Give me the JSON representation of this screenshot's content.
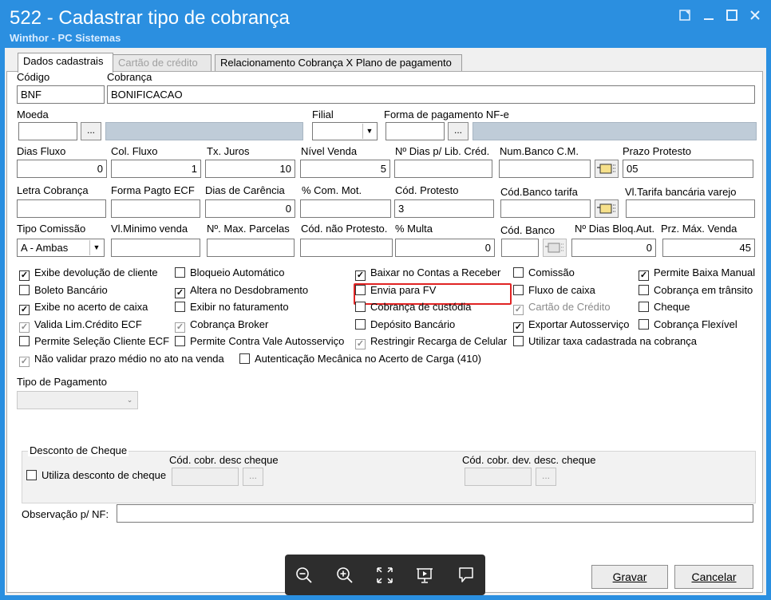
{
  "window": {
    "title": "522 - Cadastrar tipo de cobrança",
    "subtitle": "Winthor - PC Sistemas",
    "controls": [
      "restore-icon",
      "minimize-icon",
      "maximize-icon",
      "close-icon"
    ]
  },
  "tabs": [
    {
      "label": "Dados cadastrais",
      "state": "active"
    },
    {
      "label": "Cartão de crédito",
      "state": "disabled"
    },
    {
      "label": "Relacionamento Cobrança X Plano de pagamento",
      "state": "normal"
    }
  ],
  "fields": {
    "codigo": {
      "label": "Código",
      "value": "BNF"
    },
    "cobranca": {
      "label": "Cobrança",
      "value": "BONIFICACAO"
    },
    "moeda": {
      "label": "Moeda",
      "value": ""
    },
    "filial": {
      "label": "Filial",
      "value": ""
    },
    "forma_pagamento_nfe": {
      "label": "Forma de pagamento NF-e",
      "value": ""
    },
    "dias_fluxo": {
      "label": "Dias Fluxo",
      "value": "0"
    },
    "col_fluxo": {
      "label": "Col. Fluxo",
      "value": "1"
    },
    "tx_juros": {
      "label": "Tx. Juros",
      "value": "10"
    },
    "nivel_venda": {
      "label": "Nível Venda",
      "value": "5"
    },
    "dias_lib_cred": {
      "label": "Nº Dias p/ Lib. Créd.",
      "value": ""
    },
    "num_banco_cm": {
      "label": "Num.Banco C.M.",
      "value": ""
    },
    "prazo_protesto": {
      "label": "Prazo Protesto",
      "value": "05"
    },
    "letra_cobranca": {
      "label": "Letra Cobrança",
      "value": ""
    },
    "forma_pagto_ecf": {
      "label": "Forma Pagto ECF",
      "value": ""
    },
    "dias_carencia": {
      "label": "Dias de Carência",
      "value": "0"
    },
    "com_mot": {
      "label": "% Com. Mot.",
      "value": ""
    },
    "cod_protesto": {
      "label": "Cód. Protesto",
      "value": "3"
    },
    "cod_banco_tarifa": {
      "label": "Cód.Banco tarifa",
      "value": ""
    },
    "vl_tarifa_bancaria": {
      "label": "Vl.Tarifa bancária varejo",
      "value": ""
    },
    "tipo_comissao": {
      "label": "Tipo Comissão",
      "value": "A - Ambas"
    },
    "vl_minimo_venda": {
      "label": "Vl.Minimo venda",
      "value": ""
    },
    "max_parcelas": {
      "label": "Nº. Max. Parcelas",
      "value": ""
    },
    "cod_nao_protesto": {
      "label": "Cód. não Protesto.",
      "value": ""
    },
    "multa": {
      "label": "% Multa",
      "value": "0"
    },
    "cod_banco": {
      "label": "Cód. Banco",
      "value": ""
    },
    "dias_bloq_aut": {
      "label": "Nº Dias Bloq.Aut.",
      "value": "0"
    },
    "prz_max_venda": {
      "label": "Prz. Máx. Venda",
      "value": "45"
    }
  },
  "checkboxes": {
    "col1": [
      {
        "label": "Exibe devolução de cliente",
        "checked": true,
        "disabled": false
      },
      {
        "label": "Boleto Bancário",
        "checked": false,
        "disabled": false
      },
      {
        "label": "Exibe no acerto de caixa",
        "checked": true,
        "disabled": false
      },
      {
        "label": "Valida Lim.Crédito ECF",
        "checked": true,
        "disabled": true
      },
      {
        "label": "Permite Seleção Cliente ECF",
        "checked": false,
        "disabled": false
      },
      {
        "label": "Não validar prazo médio no ato na venda",
        "checked": true,
        "disabled": true
      }
    ],
    "col2": [
      {
        "label": "Bloqueio Automático",
        "checked": false,
        "disabled": false
      },
      {
        "label": "Altera no Desdobramento",
        "checked": true,
        "disabled": false
      },
      {
        "label": "Exibir no faturamento",
        "checked": false,
        "disabled": false
      },
      {
        "label": "Cobrança Broker",
        "checked": true,
        "disabled": true
      },
      {
        "label": "Permite Contra Vale Autosserviço",
        "checked": false,
        "disabled": false
      },
      {
        "label": "Autenticação Mecânica no Acerto de Carga (410)",
        "checked": false,
        "disabled": false
      }
    ],
    "col3": [
      {
        "label": "Baixar no Contas a Receber",
        "checked": true,
        "disabled": false
      },
      {
        "label": "Envia para FV",
        "checked": false,
        "disabled": false
      },
      {
        "label": "Cobrança de custódia",
        "checked": false,
        "disabled": false
      },
      {
        "label": "Depósito Bancário",
        "checked": false,
        "disabled": false
      },
      {
        "label": "Restringir Recarga de Celular",
        "checked": true,
        "disabled": true
      }
    ],
    "col4": [
      {
        "label": "Comissão",
        "checked": false,
        "disabled": false
      },
      {
        "label": "Fluxo de caixa",
        "checked": false,
        "disabled": false
      },
      {
        "label": "Cartão de Crédito",
        "checked": true,
        "disabled": true
      },
      {
        "label": "Exportar Autosserviço",
        "checked": true,
        "disabled": false
      },
      {
        "label": "Utilizar taxa cadastrada na cobrança",
        "checked": false,
        "disabled": false
      }
    ],
    "col5": [
      {
        "label": "Permite Baixa Manual",
        "checked": true,
        "disabled": false
      },
      {
        "label": "Cobrança em trânsito",
        "checked": false,
        "disabled": false
      },
      {
        "label": "Cheque",
        "checked": false,
        "disabled": false
      },
      {
        "label": "Cobrança Flexível",
        "checked": false,
        "disabled": false
      }
    ]
  },
  "tipo_pagamento": {
    "label": "Tipo de Pagamento",
    "value": ""
  },
  "desconto_cheque": {
    "title": "Desconto de Cheque",
    "utiliza_label": "Utiliza desconto de cheque",
    "utiliza_checked": false,
    "cod_desc_label": "Cód. cobr. desc cheque",
    "cod_dev_label": "Cód. cobr. dev. desc. cheque"
  },
  "observacao": {
    "label": "Observação p/ NF:",
    "value": ""
  },
  "buttons": {
    "ellipsis": "...",
    "gravar": "Gravar",
    "cancelar": "Cancelar"
  },
  "viewer_toolbar": [
    "zoom-out-icon",
    "zoom-in-icon",
    "fullscreen-icon",
    "presentation-icon",
    "comment-icon"
  ],
  "colors": {
    "titlebar": "#2b8fe0",
    "highlight": "#e02424",
    "readonly_field": "#bfccd8"
  }
}
